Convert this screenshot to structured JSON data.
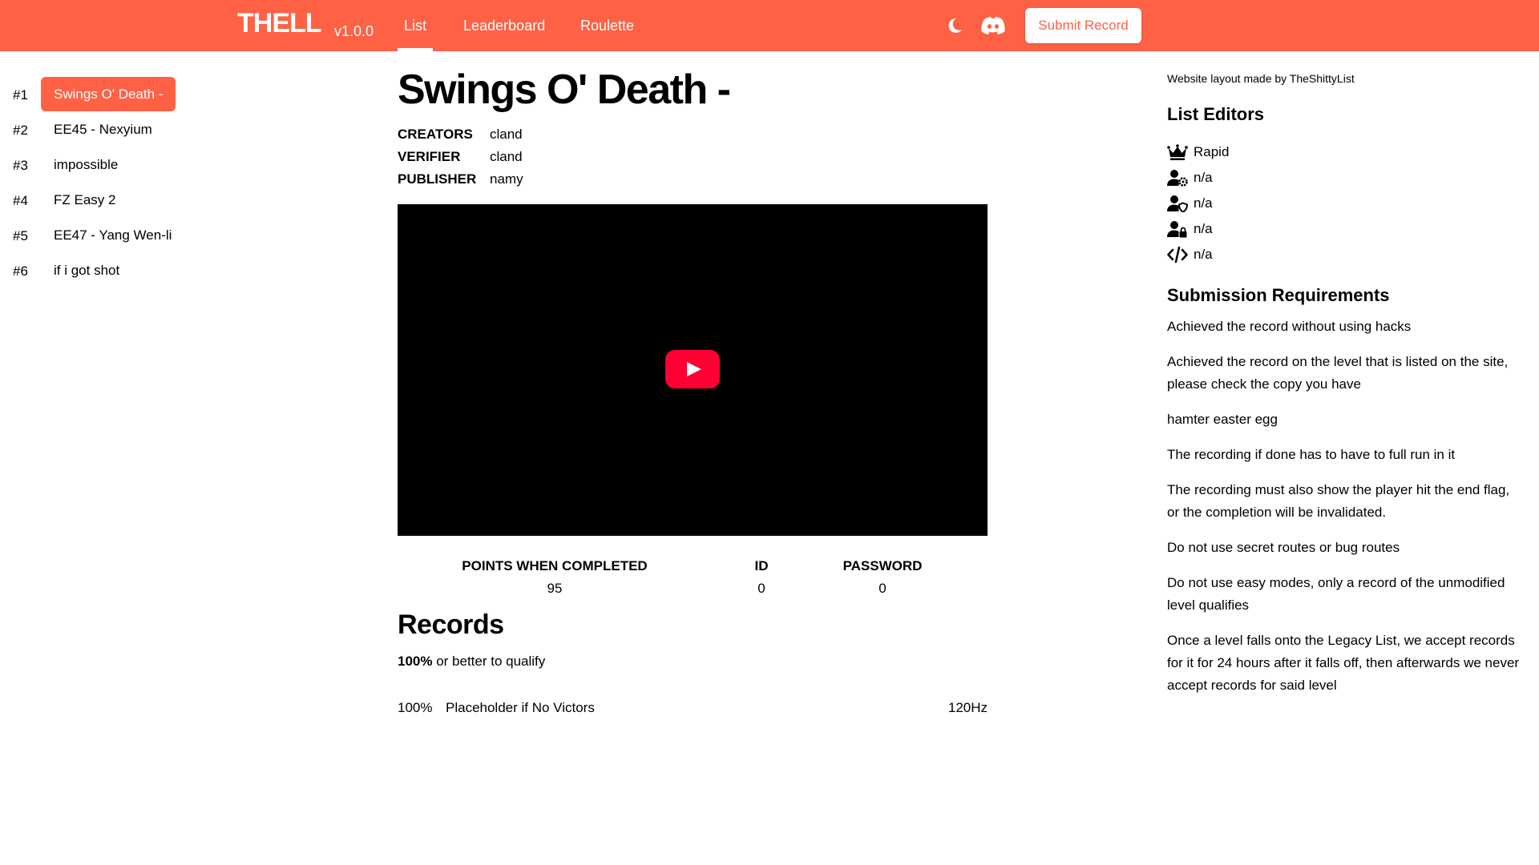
{
  "nav": {
    "brand": "THELL",
    "version": "v1.0.0",
    "links": [
      "List",
      "Leaderboard",
      "Roulette"
    ],
    "submit_label": "Submit Record",
    "icons": [
      "moon-icon",
      "discord-icon"
    ],
    "accent": "#ff6145"
  },
  "levels": [
    {
      "rank": "#1",
      "name": "Swings O' Death -"
    },
    {
      "rank": "#2",
      "name": "EE45 - Nexyium"
    },
    {
      "rank": "#3",
      "name": "impossible"
    },
    {
      "rank": "#4",
      "name": "FZ Easy 2"
    },
    {
      "rank": "#5",
      "name": "EE47 - Yang Wen-li"
    },
    {
      "rank": "#6",
      "name": "if i got shot"
    }
  ],
  "level": {
    "title": "Swings O' Death -",
    "meta": [
      {
        "key": "CREATORS",
        "value": "cland"
      },
      {
        "key": "VERIFIER",
        "value": "cland"
      },
      {
        "key": "PUBLISHER",
        "value": "namy"
      }
    ],
    "stats": [
      {
        "label": "POINTS WHEN COMPLETED",
        "value": "95"
      },
      {
        "label": "ID",
        "value": "0"
      },
      {
        "label": "PASSWORD",
        "value": "0"
      }
    ]
  },
  "records": {
    "title": "Records",
    "qualify_bold": "100%",
    "qualify_rest": " or better to qualify",
    "rows": [
      {
        "percent": "100%",
        "name": "Placeholder if No Victors",
        "hz": "120Hz"
      }
    ]
  },
  "sidebar": {
    "credit": "Website layout made by TheShittyList",
    "editors_title": "List Editors",
    "editors": [
      {
        "icon": "crown-icon",
        "name": "Rapid"
      },
      {
        "icon": "user-gear-icon",
        "name": "n/a"
      },
      {
        "icon": "user-shield-icon",
        "name": "n/a"
      },
      {
        "icon": "user-lock-icon",
        "name": "n/a"
      },
      {
        "icon": "code-icon",
        "name": "n/a"
      }
    ],
    "requirements_title": "Submission Requirements",
    "requirements": [
      "Achieved the record without using hacks",
      "Achieved the record on the level that is listed on the site, please check the copy you have",
      "hamter easter egg",
      "The recording if done has to have to full run in it",
      "The recording must also show the player hit the end flag, or the completion will be invalidated.",
      "Do not use secret routes or bug routes",
      "Do not use easy modes, only a record of the unmodified level qualifies",
      "Once a level falls onto the Legacy List, we accept records for it for 24 hours after it falls off, then afterwards we never accept records for said level"
    ]
  }
}
